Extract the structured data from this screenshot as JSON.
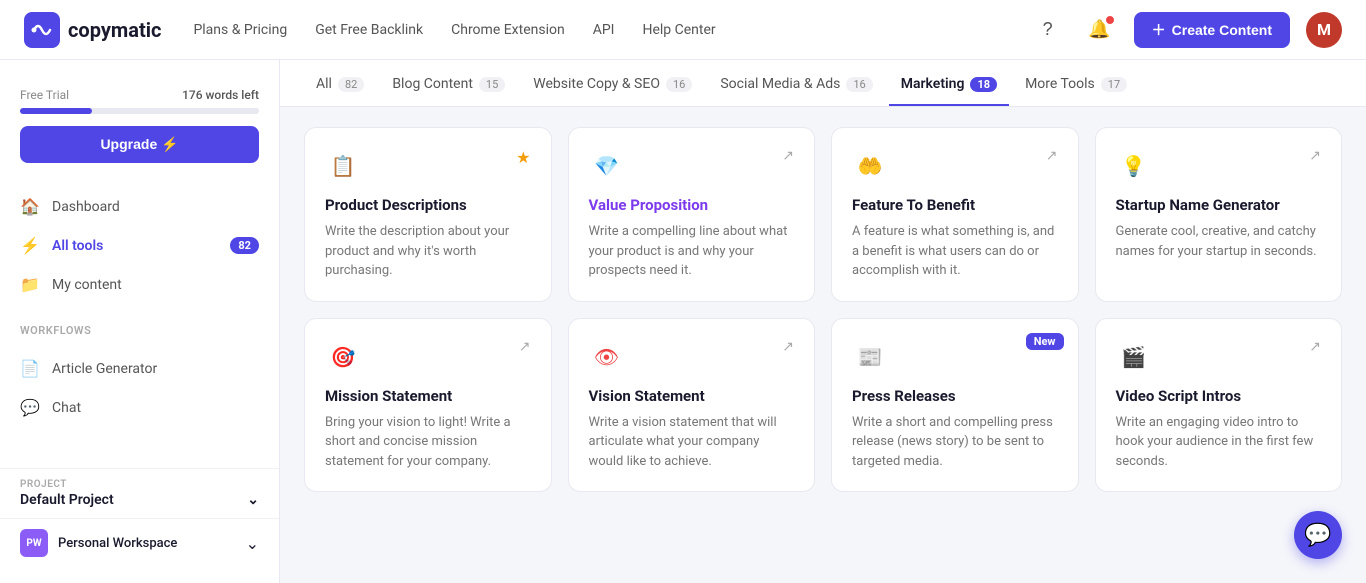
{
  "navbar": {
    "logo_text": "copymatic",
    "nav_links": [
      {
        "label": "Plans & Pricing",
        "id": "plans"
      },
      {
        "label": "Get Free Backlink",
        "id": "backlink"
      },
      {
        "label": "Chrome Extension",
        "id": "chrome"
      },
      {
        "label": "API",
        "id": "api"
      },
      {
        "label": "Help Center",
        "id": "help"
      }
    ],
    "create_button": "Create Content",
    "avatar_letter": "M"
  },
  "sidebar": {
    "trial_label": "Free Trial",
    "trial_words": "176 words left",
    "upgrade_label": "Upgrade ⚡",
    "nav_items": [
      {
        "label": "Dashboard",
        "icon": "🏠",
        "id": "dashboard",
        "active": false
      },
      {
        "label": "All tools",
        "icon": "⚡",
        "id": "alltools",
        "active": true,
        "badge": "82"
      },
      {
        "label": "My content",
        "icon": "📁",
        "id": "mycontent",
        "active": false
      }
    ],
    "workflows_label": "Workflows",
    "workflow_items": [
      {
        "label": "Article Generator",
        "icon": "📄",
        "id": "article"
      },
      {
        "label": "Chat",
        "icon": "💬",
        "id": "chat"
      }
    ],
    "project_label": "PROJECT",
    "project_name": "Default Project",
    "workspace_name": "Personal Workspace",
    "workspace_initials": "PW"
  },
  "tabs": [
    {
      "label": "All",
      "count": "82",
      "id": "all",
      "active": false,
      "count_style": "gray"
    },
    {
      "label": "Blog Content",
      "count": "15",
      "id": "blog",
      "active": false,
      "count_style": "gray"
    },
    {
      "label": "Website Copy & SEO",
      "count": "16",
      "id": "website",
      "active": false,
      "count_style": "gray"
    },
    {
      "label": "Social Media & Ads",
      "count": "16",
      "id": "social",
      "active": false,
      "count_style": "gray"
    },
    {
      "label": "Marketing",
      "count": "18",
      "id": "marketing",
      "active": true,
      "count_style": "blue"
    },
    {
      "label": "More Tools",
      "count": "17",
      "id": "more",
      "active": false,
      "count_style": "gray"
    }
  ],
  "cards": [
    {
      "id": "product-desc",
      "icon": "📋",
      "icon_color": "#e8873a",
      "title": "Product Descriptions",
      "title_highlight": false,
      "desc": "Write the description about your product and why it's worth purchasing.",
      "starred": true,
      "new_badge": false
    },
    {
      "id": "value-prop",
      "icon": "💎",
      "icon_color": "#7c3aed",
      "title": "Value Proposition",
      "title_highlight": true,
      "desc": "Write a compelling line about what your product is and why your prospects need it.",
      "starred": false,
      "new_badge": false
    },
    {
      "id": "feature-benefit",
      "icon": "🤲",
      "icon_color": "#e8873a",
      "title": "Feature To Benefit",
      "title_highlight": false,
      "desc": "A feature is what something is, and a benefit is what users can do or accomplish with it.",
      "starred": false,
      "new_badge": false
    },
    {
      "id": "startup-name",
      "icon": "💡",
      "icon_color": "#f59e0b",
      "title": "Startup Name Generator",
      "title_highlight": false,
      "desc": "Generate cool, creative, and catchy names for your startup in seconds.",
      "starred": false,
      "new_badge": false
    },
    {
      "id": "mission-statement",
      "icon": "🎯",
      "icon_color": "#e8873a",
      "title": "Mission Statement",
      "title_highlight": false,
      "desc": "Bring your vision to light! Write a short and concise mission statement for your company.",
      "starred": false,
      "new_badge": false
    },
    {
      "id": "vision-statement",
      "icon": "👁",
      "icon_color": "#ef4444",
      "title": "Vision Statement",
      "title_highlight": false,
      "desc": "Write a vision statement that will articulate what your company would like to achieve.",
      "starred": false,
      "new_badge": false
    },
    {
      "id": "press-releases",
      "icon": "📰",
      "icon_color": "#e8873a",
      "title": "Press Releases",
      "title_highlight": false,
      "desc": "Write a short and compelling press release (news story) to be sent to targeted media.",
      "starred": false,
      "new_badge": true
    },
    {
      "id": "video-script",
      "icon": "🎬",
      "icon_color": "#e8873a",
      "title": "Video Script Intros",
      "title_highlight": false,
      "desc": "Write an engaging video intro to hook your audience in the first few seconds.",
      "starred": false,
      "new_badge": false
    }
  ]
}
